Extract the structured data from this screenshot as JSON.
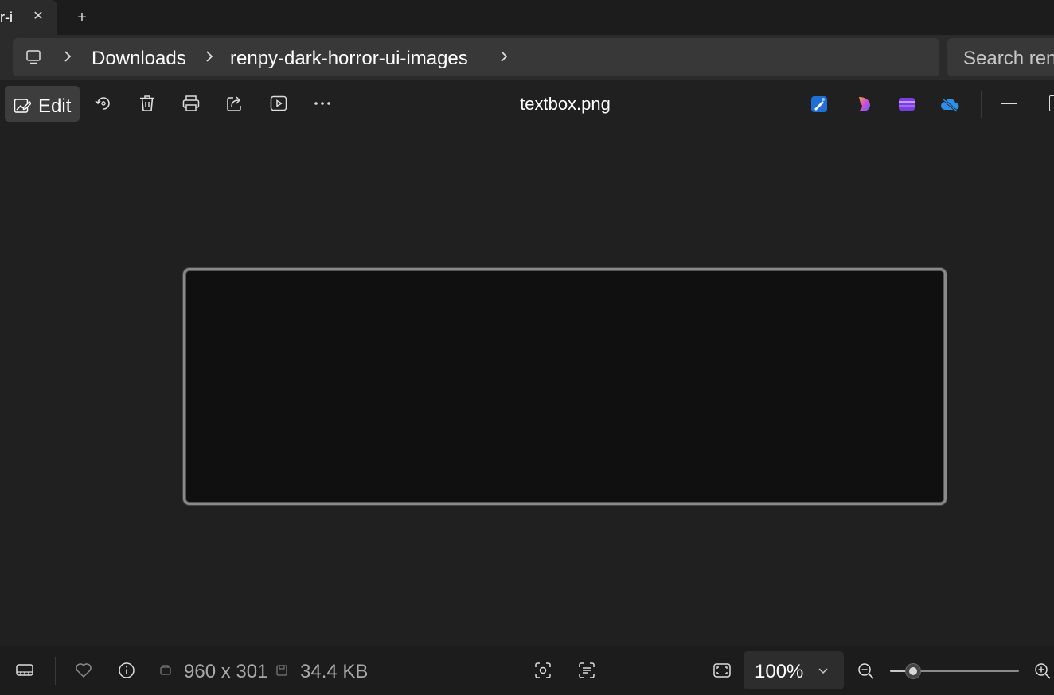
{
  "tabs": [
    {
      "label": "r-i"
    }
  ],
  "new_tab_label": "+",
  "breadcrumb": {
    "items": [
      "Downloads",
      "renpy-dark-horror-ui-images"
    ]
  },
  "search": {
    "placeholder": "Search ren"
  },
  "toolbar": {
    "edit_label": "Edit",
    "file_name": "textbox.png",
    "icons": [
      "rotate-icon",
      "delete-icon",
      "print-icon",
      "share-icon",
      "slideshow-icon",
      "more-icon"
    ],
    "app_icons": [
      "photos-editor-icon",
      "copilot-icon",
      "clipchamp-icon",
      "onedrive-icon"
    ]
  },
  "status": {
    "dimensions": "960 x 301",
    "file_size": "34.4 KB",
    "zoom": "100%",
    "zoom_slider_fraction": 0.18
  },
  "colors": {
    "background": "#202020",
    "image_fill": "#101010",
    "image_border": "#8a8a8a"
  }
}
